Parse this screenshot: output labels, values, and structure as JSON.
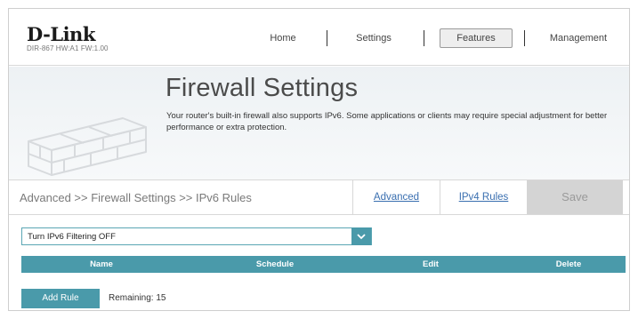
{
  "brand": {
    "logo": "D-Link",
    "model_info": "DIR-867 HW:A1 FW:1.00"
  },
  "nav": {
    "home": "Home",
    "settings": "Settings",
    "features": "Features",
    "management": "Management",
    "active": "features"
  },
  "banner": {
    "title": "Firewall Settings",
    "description": "Your router's built-in firewall also supports IPv6. Some applications or clients may require special adjustment for better performance or extra protection."
  },
  "breadcrumb": "Advanced >> Firewall Settings >> IPv6 Rules",
  "tabs": {
    "advanced": "Advanced",
    "ipv4_rules": "IPv4 Rules"
  },
  "save_label": "Save",
  "filter_select": {
    "value": "Turn IPv6 Filtering OFF"
  },
  "table": {
    "headers": [
      "Name",
      "Schedule",
      "Edit",
      "Delete"
    ]
  },
  "add_rule_label": "Add Rule",
  "remaining_text": "Remaining: 15",
  "colors": {
    "accent": "#4a9aaa",
    "link": "#3a6fb0",
    "save_disabled": "#d4d4d4"
  },
  "icons": {
    "select_arrow": "chevron-down-icon",
    "banner_art": "brick-wall-icon"
  }
}
